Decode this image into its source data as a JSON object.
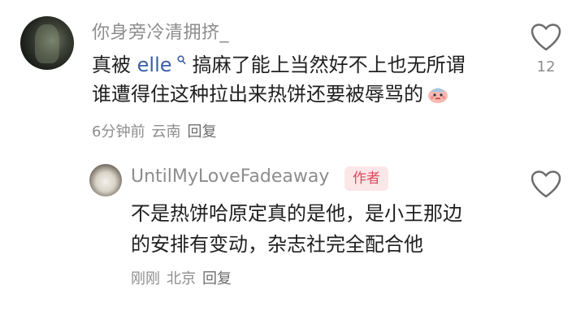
{
  "comment": {
    "username": "你身旁冷清拥挤_",
    "text_before": "真被 ",
    "mention": "elle",
    "text_line1_after": " 搞麻了能上当然好不上也无所谓",
    "text_line2": "谁遭得住这种拉出来热饼还要被辱骂的",
    "meta": {
      "time": "6分钟前",
      "location": "云南",
      "reply_label": "回复"
    },
    "like_count": "12"
  },
  "reply": {
    "username": "UntilMyLoveFadeaway",
    "badge": "作者",
    "text_line1": "不是热饼哈原定真的是他，是小王那边",
    "text_line2": "的安排有变动，杂志社完全配合他",
    "meta": {
      "time": "刚刚",
      "location": "北京",
      "reply_label": "回复"
    }
  }
}
